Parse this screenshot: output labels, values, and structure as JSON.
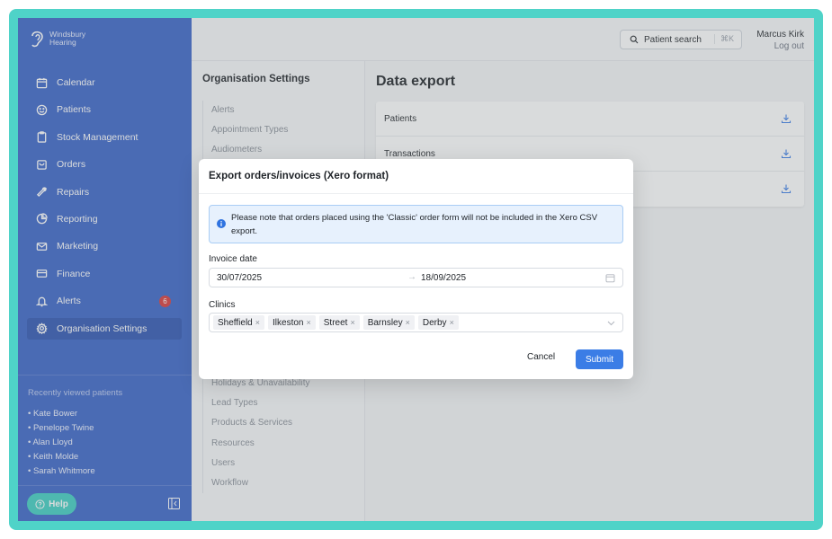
{
  "brand": {
    "line1": "Windsbury",
    "line2": "Hearing"
  },
  "nav": [
    {
      "label": "Calendar",
      "icon": "calendar-icon"
    },
    {
      "label": "Patients",
      "icon": "smiley-icon"
    },
    {
      "label": "Stock Management",
      "icon": "clipboard-icon"
    },
    {
      "label": "Orders",
      "icon": "bag-icon"
    },
    {
      "label": "Repairs",
      "icon": "wrench-icon"
    },
    {
      "label": "Reporting",
      "icon": "pie-chart-icon"
    },
    {
      "label": "Marketing",
      "icon": "mail-icon"
    },
    {
      "label": "Finance",
      "icon": "card-icon"
    },
    {
      "label": "Alerts",
      "icon": "bell-icon",
      "badge": "6"
    },
    {
      "label": "Organisation Settings",
      "icon": "gear-icon",
      "active": true
    }
  ],
  "recent": {
    "title": "Recently viewed patients",
    "items": [
      "• Kate Bower",
      "• Penelope Twine",
      "• Alan Lloyd",
      "• Keith Molde",
      "• Sarah Whitmore"
    ]
  },
  "help_label": "Help",
  "header": {
    "search_label": "Patient search",
    "search_shortcut": "⌘K",
    "user_name": "Marcus Kirk",
    "logout_label": "Log out"
  },
  "settings": {
    "title": "Organisation Settings",
    "items_top": [
      "Alerts",
      "Appointment Types",
      "Audiometers"
    ],
    "items_bottom": [
      "Holidays & Unavailability",
      "Lead Types",
      "Products & Services",
      "Resources",
      "Users",
      "Workflow"
    ]
  },
  "main": {
    "title": "Data export",
    "rows": [
      "Patients",
      "Transactions",
      ""
    ]
  },
  "modal": {
    "title": "Export orders/invoices (Xero format)",
    "notice": "Please note that orders placed using the 'Classic' order form will not be included in the Xero CSV export.",
    "invoice_label": "Invoice date",
    "date_start": "30/07/2025",
    "date_arrow": "→",
    "date_end": "18/09/2025",
    "clinics_label": "Clinics",
    "clinics": [
      "Sheffield",
      "Ilkeston",
      "Street",
      "Barnsley",
      "Derby"
    ],
    "tag_remove": "×",
    "cancel_label": "Cancel",
    "submit_label": "Submit"
  },
  "colors": {
    "sidebar": "#3a64c8",
    "accent": "#3b7de6",
    "teal": "#4fd3c8",
    "badge": "#d93a3a"
  }
}
